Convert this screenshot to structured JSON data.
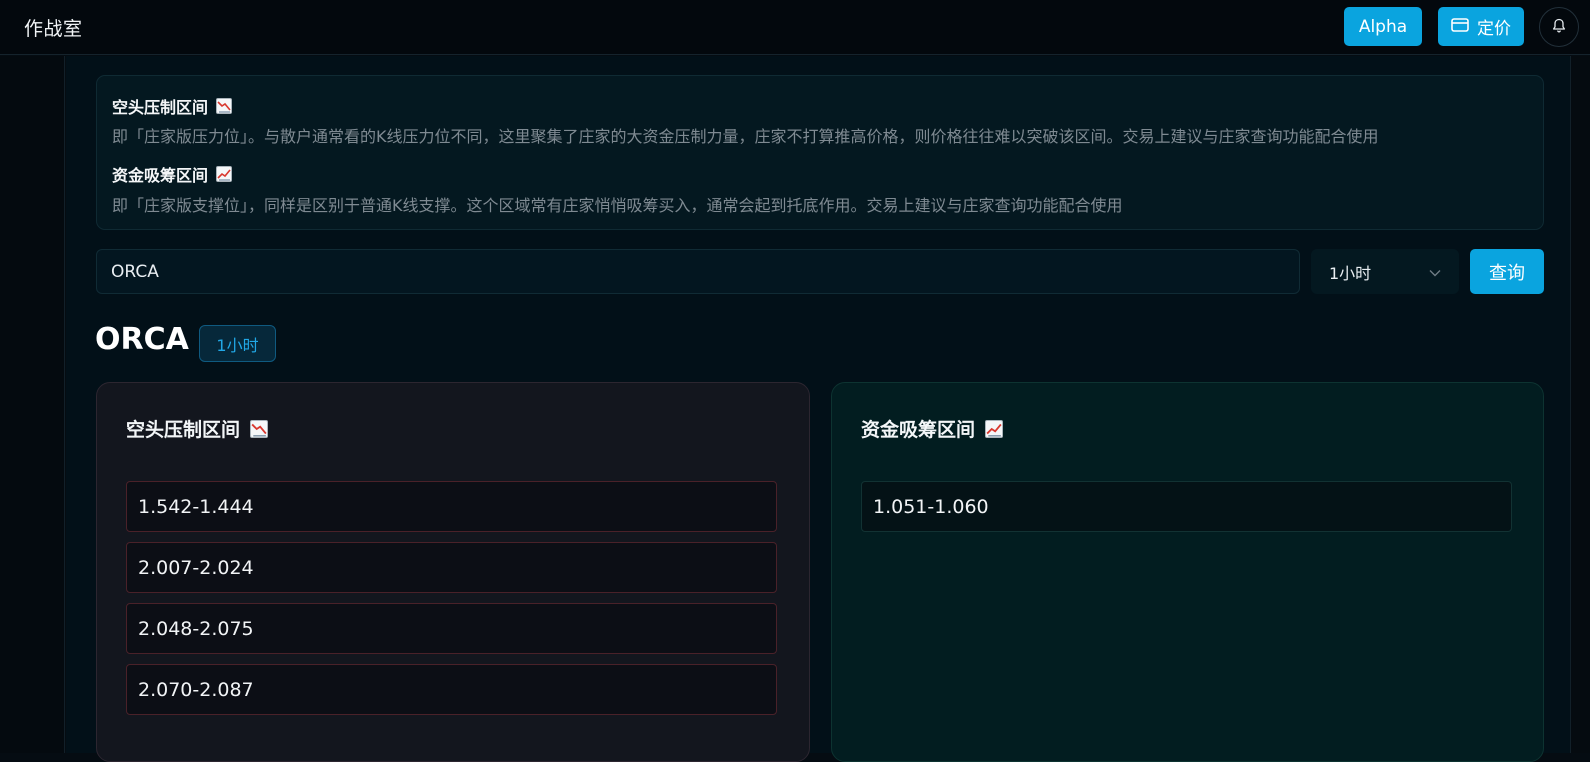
{
  "header": {
    "app_title": "作战室",
    "alpha_label": "Alpha",
    "pricing_label": "定价",
    "icons": [
      "card-icon",
      "bell-icon"
    ]
  },
  "info": {
    "resistance_title": "空头压制区间",
    "resistance_desc": "即「庄家版压力位」。与散户通常看的K线压力位不同，这里聚集了庄家的大资金压制力量，庄家不打算推高价格，则价格往往难以突破该区间。交易上建议与庄家查询功能配合使用",
    "support_title": "资金吸筹区间",
    "support_desc": "即「庄家版支撑位」，同样是区别于普通K线支撑。这个区域常有庄家悄悄吸筹买入，通常会起到托底作用。交易上建议与庄家查询功能配合使用"
  },
  "search": {
    "value": "ORCA",
    "interval": "1小时",
    "query_label": "查询"
  },
  "result": {
    "symbol": "ORCA",
    "interval_badge": "1小时",
    "resistance_title": "空头压制区间",
    "support_title": "资金吸筹区间",
    "resistance_ranges": [
      "1.542-1.444",
      "2.007-2.024",
      "2.048-2.075",
      "2.070-2.087"
    ],
    "support_ranges": [
      "1.051-1.060"
    ]
  },
  "colors": {
    "accent": "#0aa4df",
    "resistance_border": "#4a2129",
    "support_border": "#123233",
    "chart_down_red": "#d9382f",
    "chart_up_red": "#d9382f"
  }
}
